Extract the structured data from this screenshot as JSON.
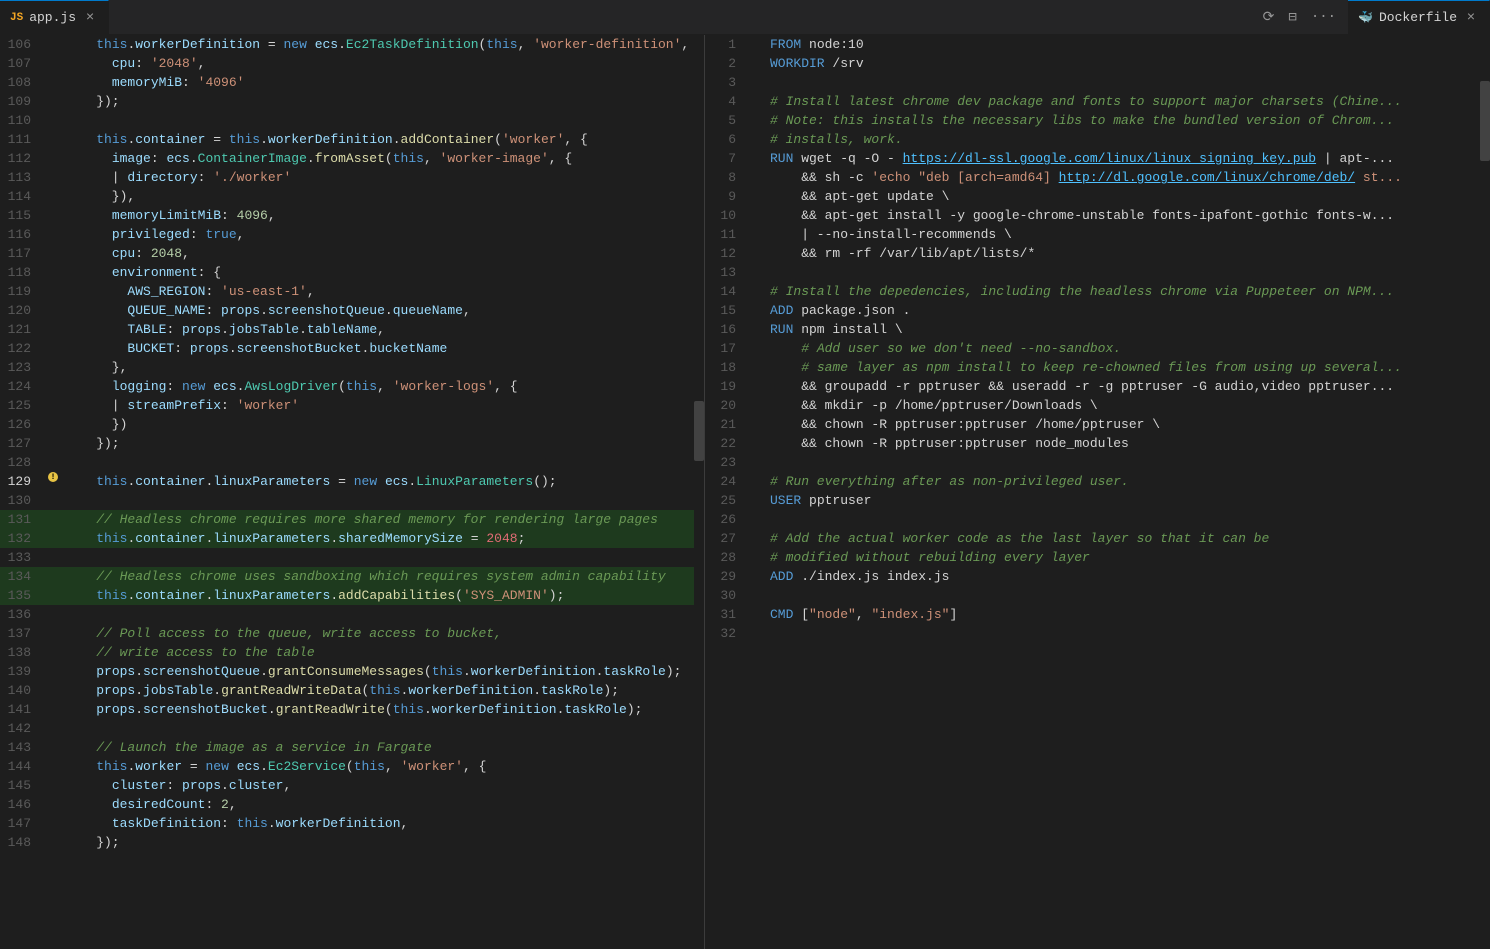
{
  "tabs": {
    "left": {
      "filename": "app.js",
      "icon": "js-icon",
      "active": true
    },
    "right": {
      "filename": "Dockerfile",
      "icon": "docker-icon",
      "active": true
    },
    "toolbar_icons": [
      "sync-icon",
      "layout-icon",
      "more-icon"
    ]
  },
  "left_editor": {
    "lines": [
      {
        "num": 106,
        "content": "    this.workerDefinition = new ecs.Ec2TaskDefinition(this, 'worker-definition', {",
        "warning": false
      },
      {
        "num": 107,
        "content": "      cpu: '2048',",
        "warning": false
      },
      {
        "num": 108,
        "content": "      memoryMiB: '4096'",
        "warning": false
      },
      {
        "num": 109,
        "content": "    });",
        "warning": false
      },
      {
        "num": 110,
        "content": "",
        "warning": false
      },
      {
        "num": 111,
        "content": "    this.container = this.workerDefinition.addContainer('worker', {",
        "warning": false
      },
      {
        "num": 112,
        "content": "      image: ecs.ContainerImage.fromAsset(this, 'worker-image', {",
        "warning": false
      },
      {
        "num": 113,
        "content": "        directory: './worker'",
        "warning": false
      },
      {
        "num": 114,
        "content": "      }),",
        "warning": false
      },
      {
        "num": 115,
        "content": "      memoryLimitMiB: 4096,",
        "warning": false
      },
      {
        "num": 116,
        "content": "      privileged: true,",
        "warning": false
      },
      {
        "num": 117,
        "content": "      cpu: 2048,",
        "warning": false
      },
      {
        "num": 118,
        "content": "      environment: {",
        "warning": false
      },
      {
        "num": 119,
        "content": "        AWS_REGION: 'us-east-1',",
        "warning": false
      },
      {
        "num": 120,
        "content": "        QUEUE_NAME: props.screenshotQueue.queueName,",
        "warning": false
      },
      {
        "num": 121,
        "content": "        TABLE: props.jobsTable.tableName,",
        "warning": false
      },
      {
        "num": 122,
        "content": "        BUCKET: props.screenshotBucket.bucketName",
        "warning": false
      },
      {
        "num": 123,
        "content": "      },",
        "warning": false
      },
      {
        "num": 124,
        "content": "      logging: new ecs.AwsLogDriver(this, 'worker-logs', {",
        "warning": false
      },
      {
        "num": 125,
        "content": "        streamPrefix: 'worker'",
        "warning": false
      },
      {
        "num": 126,
        "content": "      })",
        "warning": false
      },
      {
        "num": 127,
        "content": "    });",
        "warning": false
      },
      {
        "num": 128,
        "content": "",
        "warning": false
      },
      {
        "num": 129,
        "content": "    this.container.linuxParameters = new ecs.LinuxParameters();",
        "warning": true
      },
      {
        "num": 130,
        "content": "",
        "warning": false
      },
      {
        "num": 131,
        "content": "    // Headless chrome requires more shared memory for rendering large pages",
        "warning": false,
        "highlighted": true
      },
      {
        "num": 132,
        "content": "    this.container.linuxParameters.sharedMemorySize = 2048;",
        "warning": false,
        "highlighted": true
      },
      {
        "num": 133,
        "content": "",
        "warning": false
      },
      {
        "num": 134,
        "content": "    // Headless chrome uses sandboxing which requires system admin capability",
        "warning": false,
        "highlighted": true
      },
      {
        "num": 135,
        "content": "    this.container.linuxParameters.addCapabilities('SYS_ADMIN');",
        "warning": false,
        "highlighted": true
      },
      {
        "num": 136,
        "content": "",
        "warning": false
      },
      {
        "num": 137,
        "content": "    // Poll access to the queue, write access to bucket,",
        "warning": false
      },
      {
        "num": 138,
        "content": "    // write access to the table",
        "warning": false
      },
      {
        "num": 139,
        "content": "    props.screenshotQueue.grantConsumeMessages(this.workerDefinition.taskRole);",
        "warning": false
      },
      {
        "num": 140,
        "content": "    props.jobsTable.grantReadWriteData(this.workerDefinition.taskRole);",
        "warning": false
      },
      {
        "num": 141,
        "content": "    props.screenshotBucket.grantReadWrite(this.workerDefinition.taskRole);",
        "warning": false
      },
      {
        "num": 142,
        "content": "",
        "warning": false
      },
      {
        "num": 143,
        "content": "    // Launch the image as a service in Fargate",
        "warning": false
      },
      {
        "num": 144,
        "content": "    this.worker = new ecs.Ec2Service(this, 'worker', {",
        "warning": false
      },
      {
        "num": 145,
        "content": "      cluster: props.cluster,",
        "warning": false
      },
      {
        "num": 146,
        "content": "      desiredCount: 2,",
        "warning": false
      },
      {
        "num": 147,
        "content": "      taskDefinition: this.workerDefinition,",
        "warning": false
      },
      {
        "num": 148,
        "content": "    });",
        "warning": false
      }
    ]
  },
  "right_editor": {
    "lines": [
      {
        "num": 1,
        "content": "FROM node:10"
      },
      {
        "num": 2,
        "content": "WORKDIR /srv"
      },
      {
        "num": 3,
        "content": ""
      },
      {
        "num": 4,
        "content": "# Install latest chrome dev package and fonts to support major charsets (Chine..."
      },
      {
        "num": 5,
        "content": "# Note: this installs the necessary libs to make the bundled version of Chrom..."
      },
      {
        "num": 6,
        "content": "# installs, work."
      },
      {
        "num": 7,
        "content": "RUN wget -q -O - https://dl-ssl.google.com/linux/linux_signing_key.pub | apt-..."
      },
      {
        "num": 8,
        "content": "    && sh -c 'echo \"deb [arch=amd64] http://dl.google.com/linux/chrome/deb/ st..."
      },
      {
        "num": 9,
        "content": "    && apt-get update \\"
      },
      {
        "num": 10,
        "content": "    && apt-get install -y google-chrome-unstable fonts-ipafont-gothic fonts-w..."
      },
      {
        "num": 11,
        "content": "    | --no-install-recommends \\"
      },
      {
        "num": 12,
        "content": "    && rm -rf /var/lib/apt/lists/*"
      },
      {
        "num": 13,
        "content": ""
      },
      {
        "num": 14,
        "content": "# Install the depedencies, including the headless chrome via Puppeteer on NPM..."
      },
      {
        "num": 15,
        "content": "ADD package.json ."
      },
      {
        "num": 16,
        "content": "RUN npm install \\"
      },
      {
        "num": 17,
        "content": "    # Add user so we don't need --no-sandbox."
      },
      {
        "num": 18,
        "content": "    # same layer as npm install to keep re-chowned files from using up several..."
      },
      {
        "num": 19,
        "content": "    && groupadd -r pptruser && useradd -r -g pptruser -G audio,video pptruser..."
      },
      {
        "num": 20,
        "content": "    && mkdir -p /home/pptruser/Downloads \\"
      },
      {
        "num": 21,
        "content": "    && chown -R pptruser:pptruser /home/pptruser \\"
      },
      {
        "num": 22,
        "content": "    && chown -R pptruser:pptruser node_modules"
      },
      {
        "num": 23,
        "content": ""
      },
      {
        "num": 24,
        "content": "# Run everything after as non-privileged user."
      },
      {
        "num": 25,
        "content": "USER pptruser"
      },
      {
        "num": 26,
        "content": ""
      },
      {
        "num": 27,
        "content": "# Add the actual worker code as the last layer so that it can be"
      },
      {
        "num": 28,
        "content": "# modified without rebuilding every layer"
      },
      {
        "num": 29,
        "content": "ADD ./index.js index.js"
      },
      {
        "num": 30,
        "content": ""
      },
      {
        "num": 31,
        "content": "CMD [\"node\", \"index.js\"]"
      },
      {
        "num": 32,
        "content": ""
      }
    ]
  }
}
